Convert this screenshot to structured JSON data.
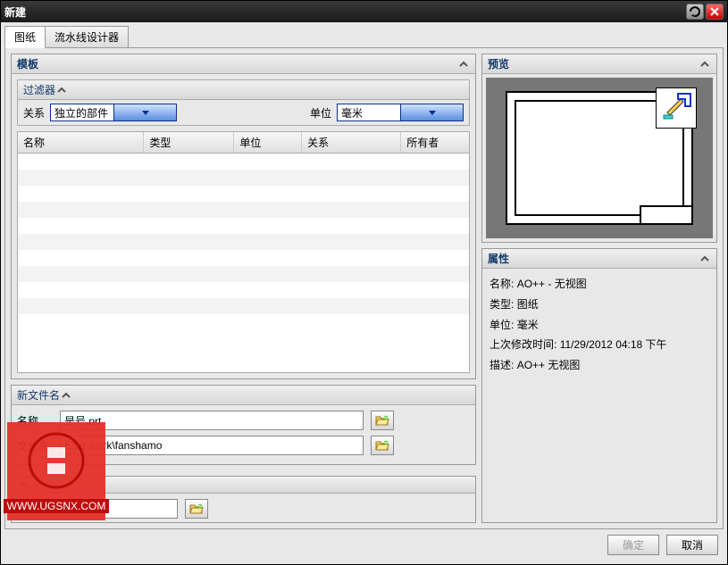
{
  "window": {
    "title": "新建"
  },
  "tabs": {
    "drawing": "图纸",
    "pipeline": "流水线设计器"
  },
  "template_panel": {
    "title": "模板",
    "filter": {
      "title": "过滤器",
      "relation_label": "关系",
      "relation_value": "独立的部件",
      "unit_label": "单位",
      "unit_value": "毫米"
    },
    "columns": {
      "name": "名称",
      "type": "类型",
      "unit": "单位",
      "relation": "关系",
      "owner": "所有者"
    }
  },
  "preview_panel": {
    "title": "预览"
  },
  "props_panel": {
    "title": "属性",
    "name_label": "名称:",
    "name_value": "AO++ - 无视图",
    "type_label": "类型:",
    "type_value": "图纸",
    "unit_label": "单位:",
    "unit_value": "毫米",
    "mod_label": "上次修改时间:",
    "mod_value": "11/29/2012 04:18 下午",
    "desc_label": "描述:",
    "desc_value": "AO++ 无视图"
  },
  "newfile": {
    "title": "新文件名",
    "name_label": "名称",
    "name_value": "是号.prt",
    "folder_label": "文件夹",
    "folder_value": "E:\\zt-work\\fanshamo"
  },
  "ref": {
    "value": ""
  },
  "buttons": {
    "ok": "确定",
    "cancel": "取消"
  },
  "watermark": {
    "url": "WWW.UGSNX.COM"
  }
}
